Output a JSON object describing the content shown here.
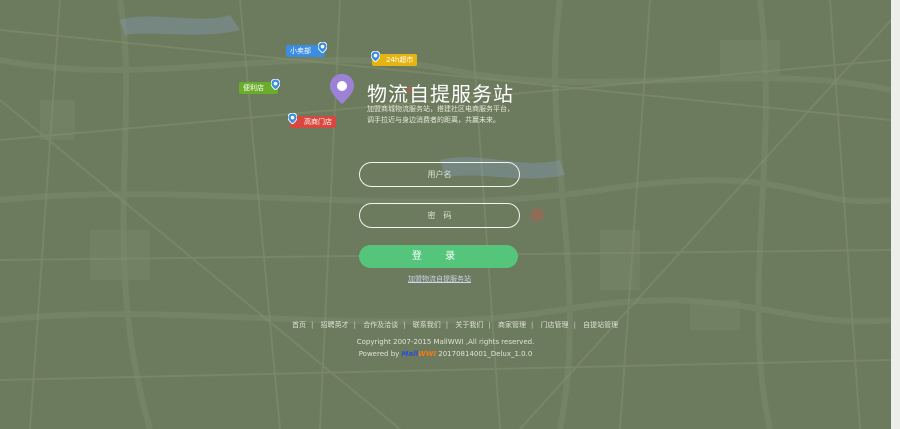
{
  "app": {
    "title": "物流自提服务站",
    "description": "加盟商城物流服务站，搭建社区电商服务平台，调手拉近与身边消费者的距离，共赢未来。"
  },
  "pins": {
    "shop": "小卖部",
    "supermarket": "24h超市",
    "convenience": "便利店",
    "store": "高商门店"
  },
  "form": {
    "username_placeholder": "用户名",
    "password_placeholder": "密　码",
    "login_label": "登 录",
    "join_link": "加盟物流自提服务站"
  },
  "footer": {
    "links": [
      "首页",
      "招聘英才",
      "合作及洽谈",
      "联系我们",
      "关于我们",
      "商家管理",
      "门店管理",
      "自提站管理"
    ],
    "copyright": "Copyright 2007-2015 MallWWI ,All rights reserved.",
    "powered_prefix": "Powered by ",
    "brand_part1": "Mall",
    "brand_part2": "WWI",
    "version": " 20170814001_Delux_1.0.0"
  },
  "colors": {
    "background": "#6c7a5e",
    "login_button": "#55c57b",
    "pin_shop": "#3a8de0",
    "pin_supermarket": "#e6b410",
    "pin_convenience": "#69ad2a",
    "pin_store": "#d9473f",
    "logo_pin": "#9b82d6"
  }
}
